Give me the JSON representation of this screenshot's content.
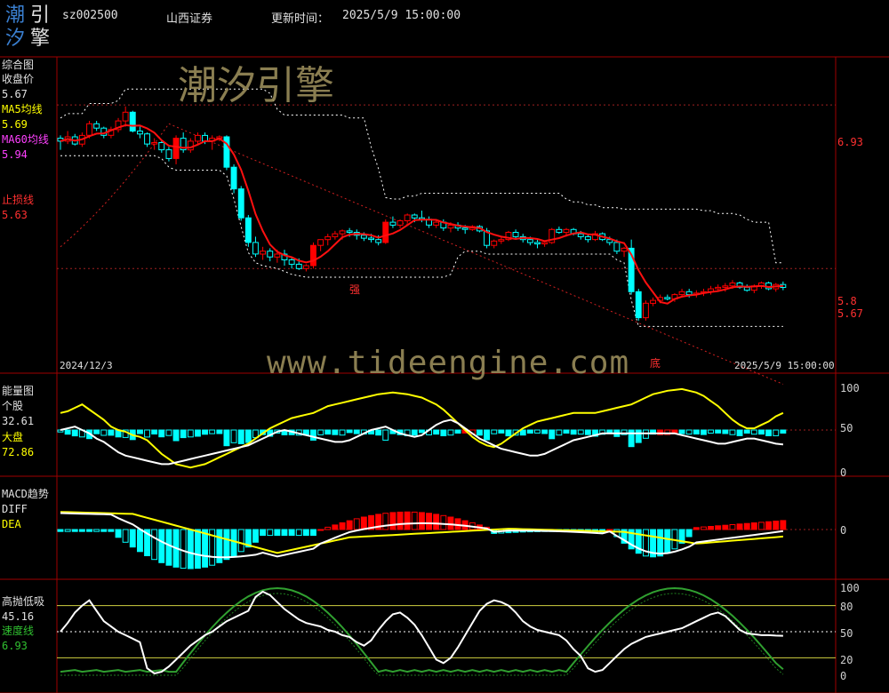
{
  "header": {
    "code": "sz002500",
    "name": "山西证券",
    "update_label": "更新时间：",
    "update_time": "2025/5/9 15:00:00"
  },
  "logo": {
    "chars": [
      "潮",
      "引",
      "汐",
      "擎"
    ]
  },
  "watermark": {
    "cn": "潮汐引擎",
    "url": "www.tideengine.com"
  },
  "colors": {
    "up": "#ff0000",
    "down": "#00ffff",
    "ma5": "#ffffff",
    "ma60": "#ff2020",
    "grid": "#a00000",
    "yellow": "#ffff00"
  },
  "panel_main": {
    "title": "综合图",
    "close_label": "收盘价",
    "close_value": "5.67",
    "ma5_label": "MA5均线",
    "ma5_value": "5.69",
    "ma60_label": "MA60均线",
    "ma60_value": "5.94",
    "stop_label": "止损线",
    "stop_value": "5.63",
    "right_labels": [
      "6.93",
      "5.8",
      "5.67"
    ],
    "date_start": "2024/12/3",
    "date_end": "2025/5/9 15:00:00",
    "marker_strong": "强",
    "marker_bottom": "底"
  },
  "panel_volume": {
    "title": "能量图",
    "stock_label": "个股",
    "stock_value": "32.61",
    "market_label": "大盘",
    "market_value": "72.86",
    "ticks": [
      "100",
      "50",
      "0"
    ]
  },
  "panel_macd": {
    "title": "MACD趋势",
    "diff_label": "DIFF",
    "dea_label": "DEA",
    "ticks": [
      "0"
    ]
  },
  "panel_osc": {
    "title": "高抛低吸",
    "value": "45.16",
    "speed_label": "速度线",
    "speed_value": "6.93",
    "ticks": [
      "100",
      "80",
      "50",
      "20",
      "0"
    ]
  },
  "chart_data": [
    {
      "type": "candlestick",
      "title": "综合图",
      "x_range": [
        "2024/12/3",
        "2025/5/9"
      ],
      "y_ticks": [
        6.93,
        5.8,
        5.67
      ],
      "ohlc": [
        [
          6.7,
          6.72,
          6.62,
          6.68
        ],
        [
          6.68,
          6.75,
          6.66,
          6.71
        ],
        [
          6.71,
          6.73,
          6.65,
          6.66
        ],
        [
          6.66,
          6.74,
          6.64,
          6.72
        ],
        [
          6.72,
          6.82,
          6.7,
          6.8
        ],
        [
          6.8,
          6.82,
          6.75,
          6.77
        ],
        [
          6.77,
          6.78,
          6.7,
          6.72
        ],
        [
          6.72,
          6.78,
          6.7,
          6.76
        ],
        [
          6.76,
          6.84,
          6.74,
          6.82
        ],
        [
          6.82,
          6.92,
          6.78,
          6.88
        ],
        [
          6.88,
          6.89,
          6.74,
          6.75
        ],
        [
          6.75,
          6.78,
          6.7,
          6.73
        ],
        [
          6.73,
          6.74,
          6.64,
          6.66
        ],
        [
          6.66,
          6.7,
          6.62,
          6.67
        ],
        [
          6.67,
          6.68,
          6.6,
          6.62
        ],
        [
          6.62,
          6.64,
          6.54,
          6.56
        ],
        [
          6.56,
          6.72,
          6.52,
          6.7
        ],
        [
          6.7,
          6.74,
          6.6,
          6.62
        ],
        [
          6.62,
          6.7,
          6.6,
          6.68
        ],
        [
          6.68,
          6.74,
          6.66,
          6.72
        ],
        [
          6.72,
          6.74,
          6.66,
          6.68
        ],
        [
          6.68,
          6.72,
          6.62,
          6.7
        ],
        [
          6.7,
          6.72,
          6.68,
          6.71
        ],
        [
          6.71,
          6.72,
          6.48,
          6.5
        ],
        [
          6.5,
          6.52,
          6.32,
          6.35
        ],
        [
          6.35,
          6.37,
          6.13,
          6.15
        ],
        [
          6.15,
          6.17,
          5.95,
          5.98
        ],
        [
          5.98,
          6.02,
          5.88,
          5.9
        ],
        [
          5.9,
          5.95,
          5.86,
          5.92
        ],
        [
          5.92,
          5.94,
          5.85,
          5.88
        ],
        [
          5.88,
          5.93,
          5.84,
          5.9
        ],
        [
          5.9,
          5.93,
          5.82,
          5.86
        ],
        [
          5.86,
          5.88,
          5.8,
          5.83
        ],
        [
          5.83,
          5.87,
          5.79,
          5.8
        ],
        [
          5.8,
          5.83,
          5.78,
          5.82
        ],
        [
          5.82,
          5.98,
          5.8,
          5.96
        ],
        [
          5.96,
          6.0,
          5.92,
          6.0
        ],
        [
          6.0,
          6.04,
          5.96,
          6.02
        ],
        [
          6.02,
          6.06,
          6.0,
          6.04
        ],
        [
          6.04,
          6.07,
          6.0,
          6.06
        ],
        [
          6.06,
          6.08,
          6.02,
          6.05
        ],
        [
          6.05,
          6.07,
          6.0,
          6.03
        ],
        [
          6.03,
          6.05,
          5.99,
          6.01
        ],
        [
          6.01,
          6.04,
          5.98,
          6.0
        ],
        [
          6.0,
          6.03,
          5.96,
          5.98
        ],
        [
          5.98,
          6.14,
          5.97,
          6.12
        ],
        [
          6.12,
          6.16,
          6.08,
          6.1
        ],
        [
          6.1,
          6.14,
          6.08,
          6.13
        ],
        [
          6.13,
          6.18,
          6.11,
          6.17
        ],
        [
          6.17,
          6.18,
          6.12,
          6.15
        ],
        [
          6.15,
          6.2,
          6.12,
          6.14
        ],
        [
          6.14,
          6.16,
          6.08,
          6.1
        ],
        [
          6.1,
          6.14,
          6.08,
          6.12
        ],
        [
          6.12,
          6.14,
          6.06,
          6.08
        ],
        [
          6.08,
          6.12,
          6.05,
          6.1
        ],
        [
          6.1,
          6.12,
          6.06,
          6.08
        ],
        [
          6.08,
          6.1,
          6.04,
          6.07
        ],
        [
          6.07,
          6.1,
          6.06,
          6.09
        ],
        [
          6.09,
          6.1,
          6.05,
          6.06
        ],
        [
          6.06,
          6.08,
          5.94,
          5.96
        ],
        [
          5.96,
          6.0,
          5.94,
          5.99
        ],
        [
          5.99,
          6.02,
          5.97,
          6.0
        ],
        [
          6.0,
          6.06,
          5.99,
          6.05
        ],
        [
          6.05,
          6.07,
          6.0,
          6.02
        ],
        [
          6.02,
          6.04,
          5.98,
          6.0
        ],
        [
          6.0,
          6.02,
          5.96,
          5.98
        ],
        [
          5.98,
          6.0,
          5.94,
          5.97
        ],
        [
          5.97,
          5.99,
          5.95,
          5.98
        ],
        [
          5.98,
          6.08,
          5.97,
          6.07
        ],
        [
          6.07,
          6.09,
          6.04,
          6.05
        ],
        [
          6.05,
          6.08,
          6.02,
          6.07
        ],
        [
          6.07,
          6.08,
          6.03,
          6.04
        ],
        [
          6.04,
          6.06,
          6.0,
          6.02
        ],
        [
          6.02,
          6.04,
          5.98,
          6.0
        ],
        [
          6.0,
          6.06,
          5.99,
          6.04
        ],
        [
          6.04,
          6.05,
          5.99,
          6.0
        ],
        [
          6.0,
          6.02,
          5.96,
          5.98
        ],
        [
          5.98,
          6.0,
          5.9,
          5.92
        ],
        [
          5.92,
          5.95,
          5.88,
          5.94
        ],
        [
          5.94,
          6.0,
          5.62,
          5.64
        ],
        [
          5.64,
          5.66,
          5.44,
          5.46
        ],
        [
          5.46,
          5.58,
          5.44,
          5.56
        ],
        [
          5.56,
          5.6,
          5.54,
          5.58
        ],
        [
          5.58,
          5.62,
          5.56,
          5.6
        ],
        [
          5.6,
          5.62,
          5.58,
          5.59
        ],
        [
          5.59,
          5.63,
          5.57,
          5.62
        ],
        [
          5.62,
          5.66,
          5.6,
          5.64
        ],
        [
          5.64,
          5.66,
          5.6,
          5.62
        ],
        [
          5.62,
          5.65,
          5.6,
          5.63
        ],
        [
          5.63,
          5.66,
          5.61,
          5.64
        ],
        [
          5.64,
          5.68,
          5.62,
          5.66
        ],
        [
          5.66,
          5.69,
          5.64,
          5.67
        ],
        [
          5.67,
          5.7,
          5.64,
          5.68
        ],
        [
          5.68,
          5.72,
          5.66,
          5.7
        ],
        [
          5.7,
          5.71,
          5.66,
          5.67
        ],
        [
          5.67,
          5.69,
          5.64,
          5.65
        ],
        [
          5.65,
          5.69,
          5.63,
          5.68
        ],
        [
          5.68,
          5.71,
          5.66,
          5.7
        ],
        [
          5.7,
          5.71,
          5.65,
          5.66
        ],
        [
          5.66,
          5.7,
          5.64,
          5.69
        ],
        [
          5.69,
          5.71,
          5.65,
          5.67
        ]
      ],
      "ma5_last": 5.69,
      "ma60_last": 5.94,
      "stop_last": 5.63
    },
    {
      "type": "bar+line",
      "title": "能量图",
      "y_ticks": [
        0,
        50,
        100
      ],
      "series": [
        {
          "name": "个股",
          "last": 32.61
        },
        {
          "name": "大盘",
          "last": 72.86
        }
      ]
    },
    {
      "type": "bar+line",
      "title": "MACD趋势",
      "y_ticks": [
        0
      ],
      "series": [
        {
          "name": "DIFF"
        },
        {
          "name": "DEA"
        }
      ]
    },
    {
      "type": "line",
      "title": "高抛低吸",
      "y_ticks": [
        0,
        20,
        50,
        80,
        100
      ],
      "series": [
        {
          "name": "高抛低吸",
          "last": 45.16
        },
        {
          "name": "速度线",
          "last": 6.93
        }
      ]
    }
  ]
}
